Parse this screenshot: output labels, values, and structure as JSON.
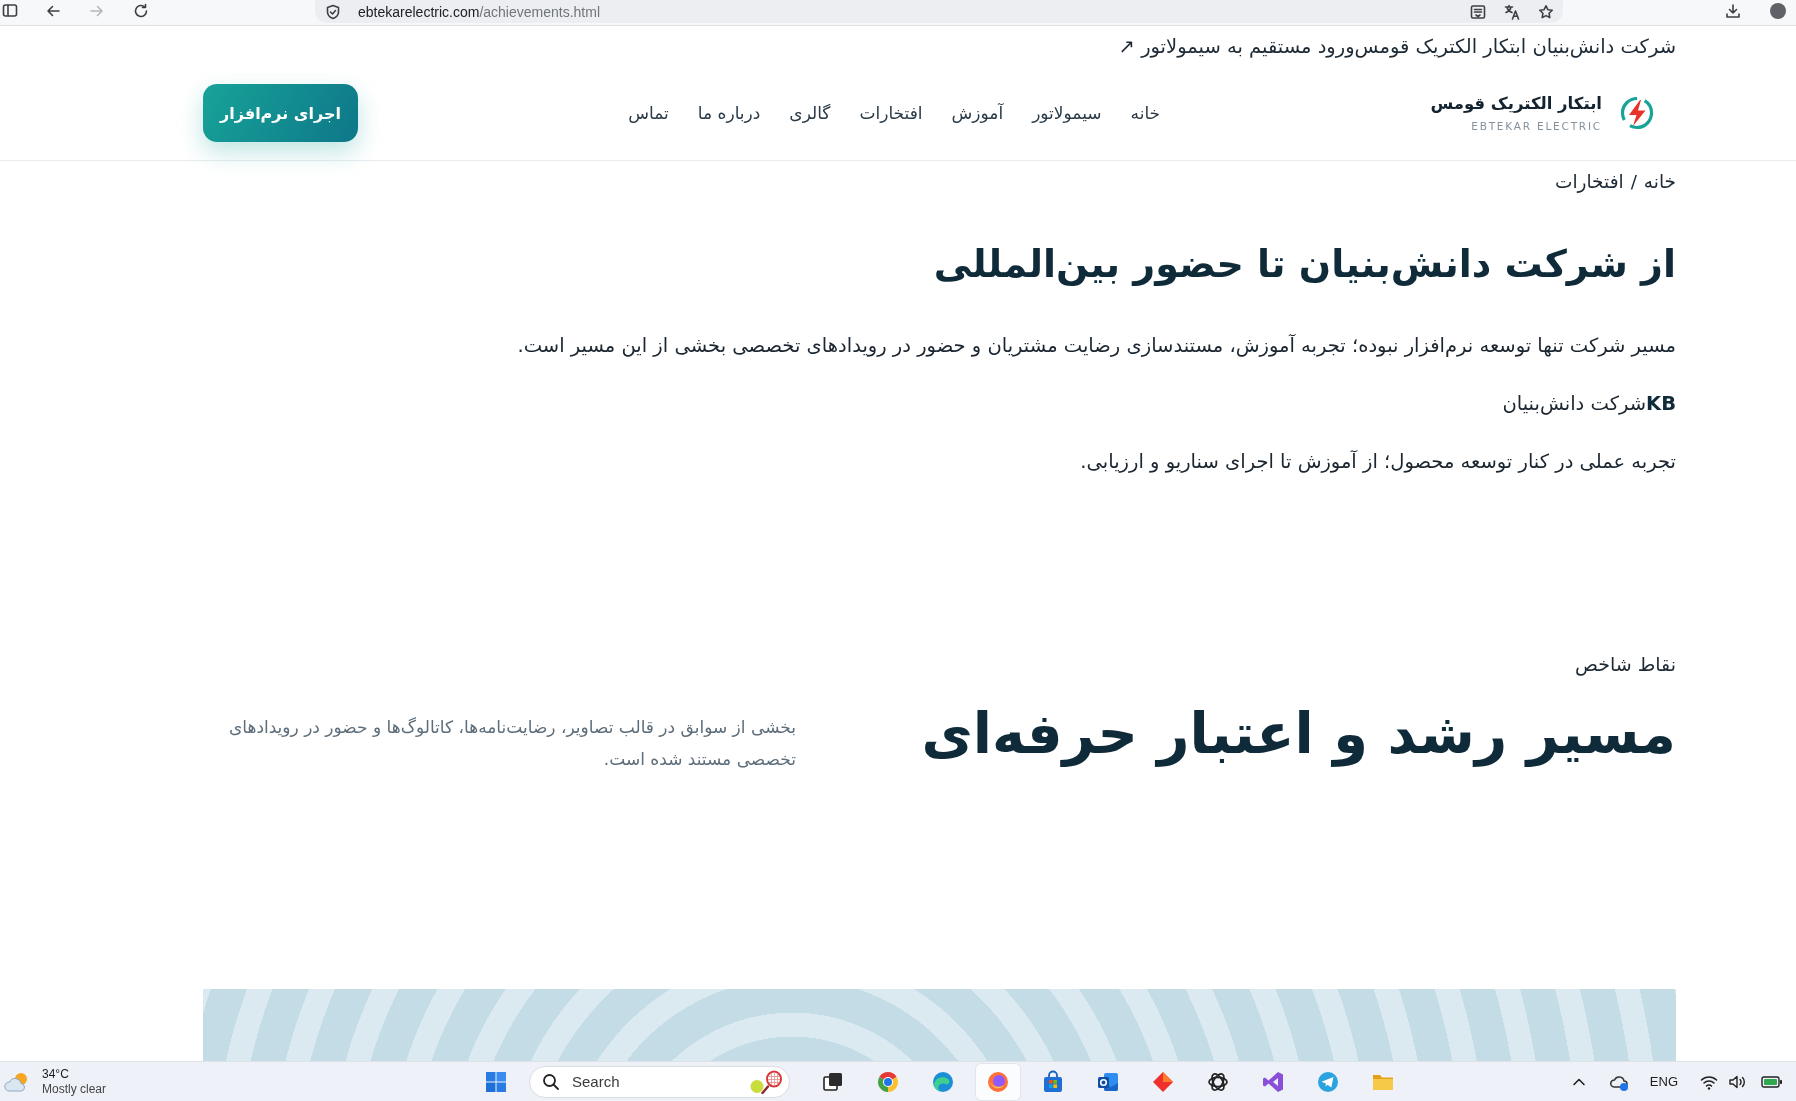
{
  "browser": {
    "nav_buttons": [
      {
        "kind": "back",
        "disabled": false
      },
      {
        "kind": "forward",
        "disabled": true
      },
      {
        "kind": "reload",
        "disabled": false
      }
    ],
    "url_host": "ebtekarelectric.com",
    "url_path": "/achievements.html"
  },
  "top_bar": {
    "company": "شرکت دانش‌بنیان ابتکار الکتریک قومس",
    "link": "ورود مستقیم به سیمولاتور ↗"
  },
  "header": {
    "brand": {
      "title": "ابتکار الکتریک قومس",
      "subtitle": "EBTEKAR ELECTRIC"
    },
    "nav": [
      {
        "label": "خانه"
      },
      {
        "label": "سیمولاتور"
      },
      {
        "label": "آموزش"
      },
      {
        "label": "افتخارات"
      },
      {
        "label": "گالری"
      },
      {
        "label": "درباره ما"
      },
      {
        "label": "تماس"
      }
    ],
    "cta": "اجرای نرم‌افزار"
  },
  "breadcrumb": {
    "items": [
      "خانه",
      "افتخارات"
    ],
    "separator": "/"
  },
  "intro": {
    "title": "از شرکت دانش‌بنیان تا حضور بین‌المللی",
    "paragraphs": [
      "مسیر شرکت تنها توسعه نرم‌افزار نبوده؛ تجربه آموزش، مستندسازی رضایت مشتریان و حضور در رویدادهای تخصصی بخشی از این مسیر است.",
      "**KB**شرکت دانش‌بنیان",
      "تجربه عملی در کنار توسعه محصول؛ از آموزش تا اجرای سناریو و ارزیابی."
    ]
  },
  "highlights": {
    "eyebrow": "نقاط شاخص",
    "title": "مسیر رشد و اعتبار حرفه‌ای",
    "description": "بخشی از سوابق در قالب تصاویر، رضایت‌نامه‌ها، کاتالوگ‌ها و حضور در رویدادهای تخصصی مستند شده است."
  },
  "taskbar": {
    "weather": {
      "temperature": "34°C",
      "condition": "Mostly clear"
    },
    "search": {
      "placeholder": "Search"
    },
    "apps": [
      {
        "kind": "taskview",
        "active": false
      },
      {
        "kind": "wheel",
        "active": false
      },
      {
        "kind": "swirl",
        "active": false
      },
      {
        "kind": "flame",
        "active": true
      },
      {
        "kind": "store",
        "active": false
      },
      {
        "kind": "mail",
        "active": false
      },
      {
        "kind": "diamond",
        "active": false
      },
      {
        "kind": "knot",
        "active": false
      },
      {
        "kind": "ribbon",
        "active": false
      },
      {
        "kind": "plane",
        "active": false
      },
      {
        "kind": "folder",
        "active": false
      }
    ],
    "language": "ENG"
  }
}
